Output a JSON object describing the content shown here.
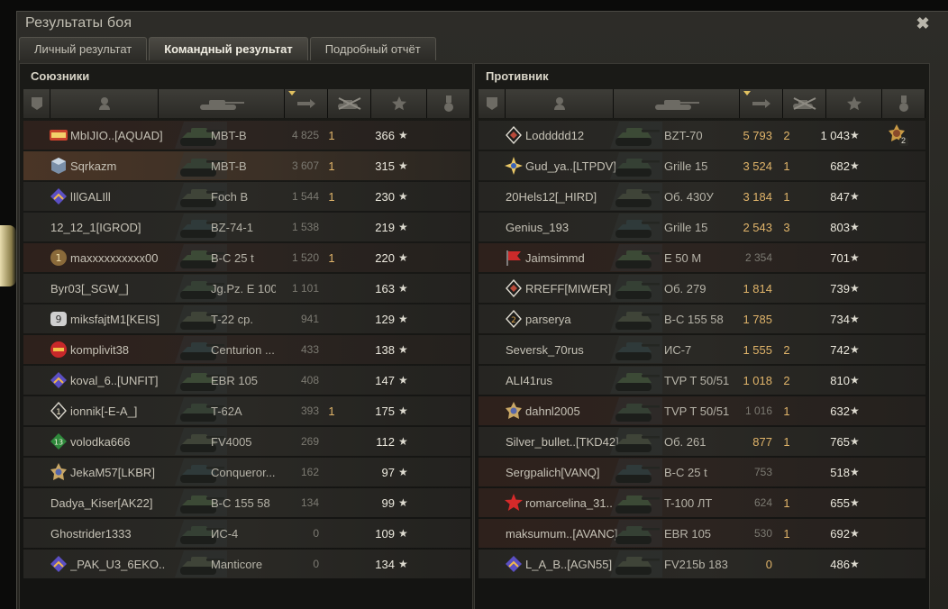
{
  "window": {
    "title": "Результаты боя",
    "close_label": "✖"
  },
  "tabs": [
    {
      "label": "Личный результат",
      "active": false
    },
    {
      "label": "Командный результат",
      "active": true
    },
    {
      "label": "Подробный отчёт",
      "active": false
    }
  ],
  "colors": {
    "gold": "#e0b46a",
    "dim": "#7c7a72",
    "text": "#c6c2b6"
  },
  "allies": {
    "title": "Союзники",
    "headers": [
      "squad-icon",
      "player-icon",
      "tank-icon",
      "damage-icon",
      "frags-icon",
      "xp-star-icon",
      "medal-icon"
    ],
    "rows": [
      {
        "name": "MbIJIO..[AQUAD]",
        "badge": "clan-badge-legwa",
        "tank": "MBT-B",
        "damage": "4 825",
        "frags": "1",
        "xp": "366",
        "style": "reddish",
        "dmg_gold": false
      },
      {
        "name": "Sqrkazm",
        "badge": "cube-badge",
        "tank": "MBT-B",
        "damage": "3 607",
        "frags": "1",
        "xp": "315",
        "style": "hl",
        "dmg_gold": false
      },
      {
        "name": "lIlGALIll",
        "badge": "chevron-badge",
        "tank": "Foch B",
        "damage": "1 544",
        "frags": "1",
        "xp": "230",
        "style": "",
        "dmg_gold": false
      },
      {
        "name": "12_12_1[IGROD]",
        "badge": "",
        "tank": "BZ-74-1",
        "damage": "1 538",
        "frags": "",
        "xp": "219",
        "style": "",
        "dmg_gold": false
      },
      {
        "name": "maxxxxxxxxxx00",
        "badge": "number-1-badge",
        "tank": "B-C 25 t",
        "damage": "1 520",
        "frags": "1",
        "xp": "220",
        "style": "reddish",
        "dmg_gold": false
      },
      {
        "name": "Byr03[_SGW_]",
        "badge": "",
        "tank": "Jg.Pz. E 100",
        "damage": "1 101",
        "frags": "",
        "xp": "163",
        "style": "",
        "dmg_gold": false
      },
      {
        "name": "miksfajtM1[KEIS]",
        "badge": "number-9-badge",
        "tank": "T-22 ср.",
        "damage": "941",
        "frags": "",
        "xp": "129",
        "style": "",
        "dmg_gold": false
      },
      {
        "name": "komplivit38",
        "badge": "red-badge",
        "tank": "Centurion ...",
        "damage": "433",
        "frags": "",
        "xp": "138",
        "style": "reddish",
        "dmg_gold": false
      },
      {
        "name": "koval_6..[UNFIT]",
        "badge": "chevron-badge",
        "tank": "EBR 105",
        "damage": "408",
        "frags": "",
        "xp": "147",
        "style": "",
        "dmg_gold": false
      },
      {
        "name": "ionnik[-E-A_]",
        "badge": "diamond-1-badge",
        "tank": "T-62A",
        "damage": "393",
        "frags": "1",
        "xp": "175",
        "style": "",
        "dmg_gold": false
      },
      {
        "name": "volodka666",
        "badge": "green-13-badge",
        "tank": "FV4005",
        "damage": "269",
        "frags": "",
        "xp": "112",
        "style": "",
        "dmg_gold": false
      },
      {
        "name": "JekaM57[LKBR]",
        "badge": "emblem-badge",
        "tank": "Conqueror...",
        "damage": "162",
        "frags": "",
        "xp": "97",
        "style": "",
        "dmg_gold": false
      },
      {
        "name": "Dadya_Kiser[AK22]",
        "badge": "",
        "tank": "B-C 155 58",
        "damage": "134",
        "frags": "",
        "xp": "99",
        "style": "",
        "dmg_gold": false
      },
      {
        "name": "Ghostrider1333",
        "badge": "",
        "tank": "ИС-4",
        "damage": "0",
        "frags": "",
        "xp": "109",
        "style": "",
        "dmg_gold": false
      },
      {
        "name": "_PAK_U3_6EKO..",
        "badge": "chevron-badge",
        "tank": "Manticore",
        "damage": "0",
        "frags": "",
        "xp": "134",
        "style": "",
        "dmg_gold": false
      }
    ]
  },
  "enemies": {
    "title": "Противник",
    "rows": [
      {
        "name": "Loddddd12",
        "badge": "diamond-badge",
        "tank": "BZT-70",
        "damage": "5 793",
        "frags": "2",
        "xp": "1 043",
        "style": "",
        "dmg_gold": true,
        "medal": "2"
      },
      {
        "name": "Gud_ya..[LTPDV]",
        "badge": "star-badge",
        "tank": "Grille 15",
        "damage": "3 524",
        "frags": "1",
        "xp": "682",
        "style": "",
        "dmg_gold": true
      },
      {
        "name": "20Hels12[_HIRD]",
        "badge": "",
        "tank": "Об. 430У",
        "damage": "3 184",
        "frags": "1",
        "xp": "847",
        "style": "",
        "dmg_gold": true
      },
      {
        "name": "Genius_193",
        "badge": "",
        "tank": "Grille 15",
        "damage": "2 543",
        "frags": "3",
        "xp": "803",
        "style": "",
        "dmg_gold": true
      },
      {
        "name": "Jaimsimmd",
        "badge": "red-flag-badge",
        "tank": "E 50 M",
        "damage": "2 354",
        "frags": "",
        "xp": "701",
        "style": "reddish",
        "dmg_gold": false
      },
      {
        "name": "RREFF[MIWER]",
        "badge": "diamond-badge",
        "tank": "Об. 279",
        "damage": "1 814",
        "frags": "",
        "xp": "739",
        "style": "",
        "dmg_gold": true
      },
      {
        "name": "parserya",
        "badge": "diamond-2-badge",
        "tank": "B-C 155 58",
        "damage": "1 785",
        "frags": "",
        "xp": "734",
        "style": "",
        "dmg_gold": true
      },
      {
        "name": "Seversk_70rus",
        "badge": "",
        "tank": "ИС-7",
        "damage": "1 555",
        "frags": "2",
        "xp": "742",
        "style": "",
        "dmg_gold": true
      },
      {
        "name": "ALI41rus",
        "badge": "",
        "tank": "TVP T 50/51",
        "damage": "1 018",
        "frags": "2",
        "xp": "810",
        "style": "",
        "dmg_gold": true
      },
      {
        "name": "dahnl2005",
        "badge": "emblem-badge",
        "tank": "TVP T 50/51",
        "damage": "1 016",
        "frags": "1",
        "xp": "632",
        "style": "reddish",
        "dmg_gold": false
      },
      {
        "name": "Silver_bullet..[TKD42]",
        "badge": "",
        "tank": "Об. 261",
        "damage": "877",
        "frags": "1",
        "xp": "765",
        "style": "",
        "dmg_gold": true
      },
      {
        "name": "Sergpalich[VANQ]",
        "badge": "",
        "tank": "B-C 25 t",
        "damage": "753",
        "frags": "",
        "xp": "518",
        "style": "reddish",
        "dmg_gold": false
      },
      {
        "name": "romarcelina_31..",
        "badge": "red-star-badge",
        "tank": "T-100 ЛТ",
        "damage": "624",
        "frags": "1",
        "xp": "655",
        "style": "reddish",
        "dmg_gold": false
      },
      {
        "name": "maksumum..[AVANC]",
        "badge": "",
        "tank": "EBR 105",
        "damage": "530",
        "frags": "1",
        "xp": "692",
        "style": "reddish",
        "dmg_gold": false
      },
      {
        "name": "L_A_B..[AGN55]",
        "badge": "chevron-badge",
        "tank": "FV215b 183",
        "damage": "0",
        "frags": "",
        "xp": "486",
        "style": "",
        "dmg_gold": true
      }
    ]
  },
  "star_glyph": "★"
}
